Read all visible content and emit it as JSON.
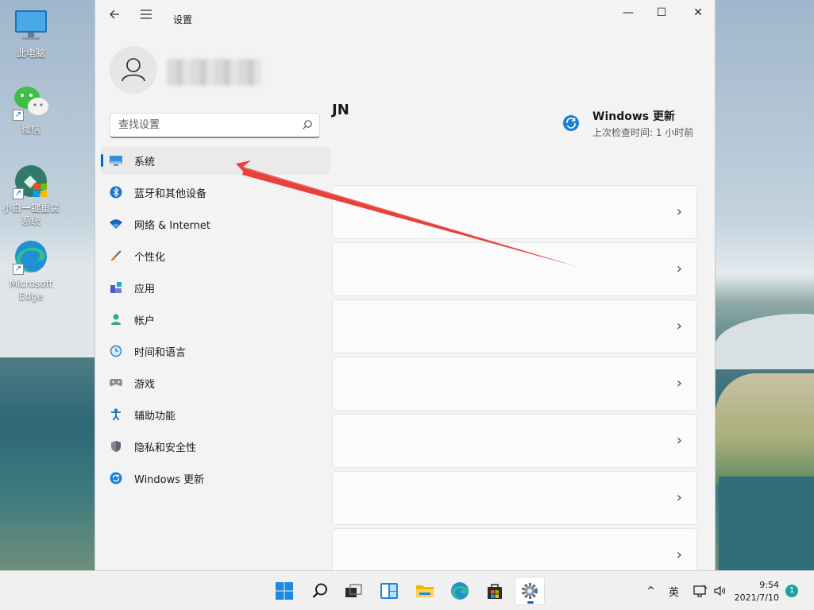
{
  "desktop": {
    "icons": [
      {
        "label": "此电脑",
        "icon": "computer-icon"
      },
      {
        "label": "微信",
        "icon": "wechat-icon"
      },
      {
        "label": "小白一键重装系统",
        "icon": "reinstall-tool-icon"
      },
      {
        "label": "Microsoft Edge",
        "icon": "edge-icon"
      }
    ]
  },
  "window": {
    "title": "设置",
    "controls": {
      "minimize": "—",
      "maximize": "☐",
      "close": "✕"
    }
  },
  "account": {
    "avatar_icon": "person-icon"
  },
  "search": {
    "placeholder": "查找设置",
    "value": ""
  },
  "nav": {
    "items": [
      {
        "label": "系统",
        "icon": "display-icon",
        "active": true
      },
      {
        "label": "蓝牙和其他设备",
        "icon": "bluetooth-icon"
      },
      {
        "label": "网络 & Internet",
        "icon": "wifi-icon"
      },
      {
        "label": "个性化",
        "icon": "brush-icon"
      },
      {
        "label": "应用",
        "icon": "apps-icon"
      },
      {
        "label": "帐户",
        "icon": "account-icon"
      },
      {
        "label": "时间和语言",
        "icon": "clock-globe-icon"
      },
      {
        "label": "游戏",
        "icon": "gamepad-icon"
      },
      {
        "label": "辅助功能",
        "icon": "accessibility-icon"
      },
      {
        "label": "隐私和安全性",
        "icon": "shield-icon"
      },
      {
        "label": "Windows 更新",
        "icon": "update-icon"
      }
    ]
  },
  "main": {
    "pc_name_fragment": "JN",
    "windows_update": {
      "title": "Windows 更新",
      "subtitle": "上次检查时间: 1 小时前"
    },
    "cards": [
      {
        "chevron": "›"
      },
      {
        "chevron": "›"
      },
      {
        "chevron": "›"
      },
      {
        "chevron": "›"
      },
      {
        "chevron": "›"
      },
      {
        "chevron": "›"
      },
      {
        "chevron": "›"
      }
    ]
  },
  "taskbar": {
    "apps": [
      "start-icon",
      "search-icon",
      "task-view-icon",
      "widgets-icon",
      "file-explorer-icon",
      "edge-icon",
      "store-icon",
      "settings-icon"
    ],
    "tray": {
      "chevron": "^",
      "ime": "英"
    },
    "clock": {
      "time": "9:54",
      "date": "2021/7/10"
    },
    "notifications": "1"
  },
  "colors": {
    "accent": "#0067c0",
    "annotation_arrow": "#e8403a"
  }
}
